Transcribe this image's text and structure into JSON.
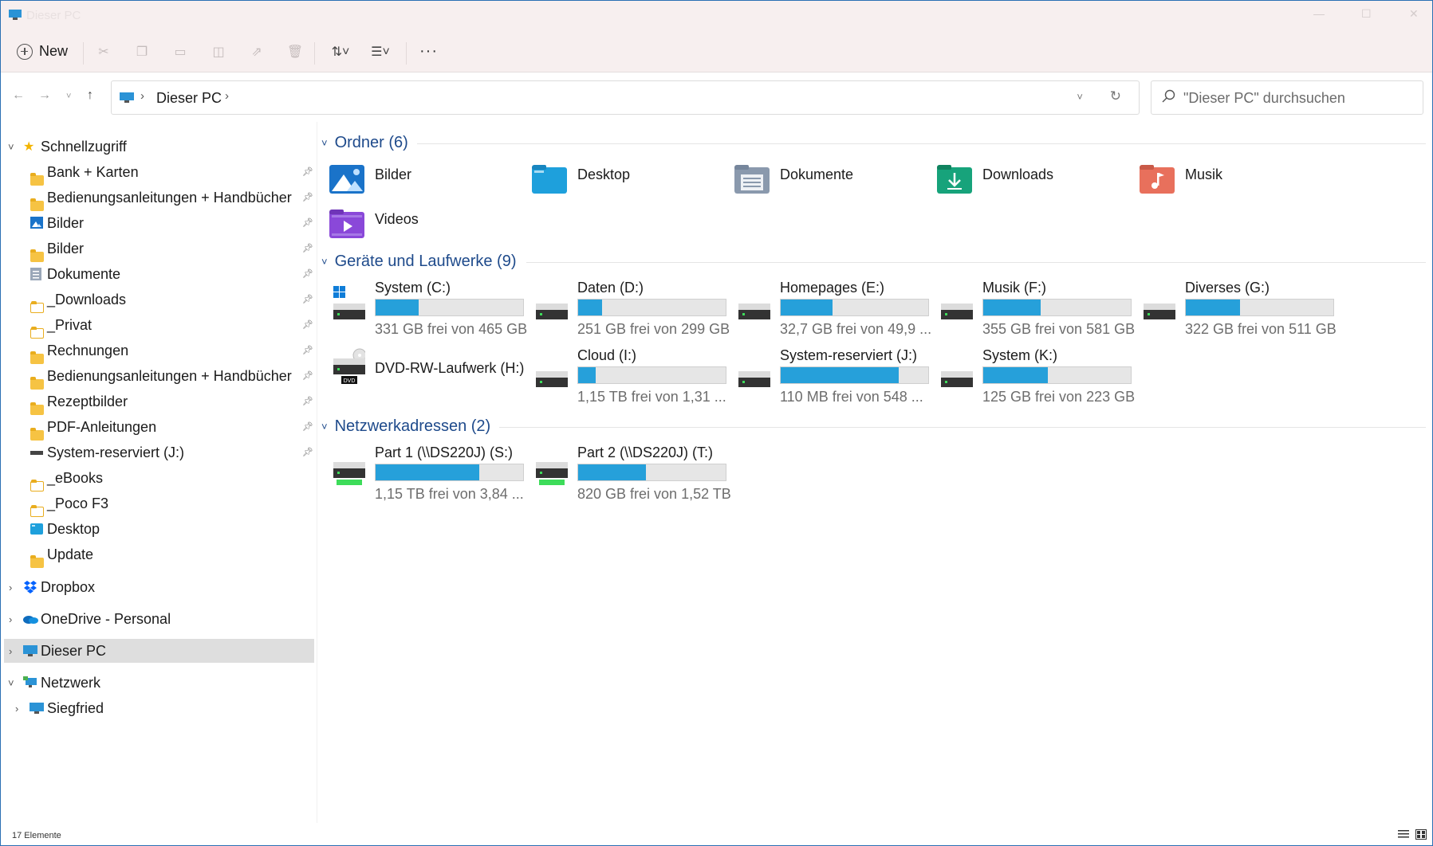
{
  "window": {
    "title": "Dieser PC"
  },
  "toolbar": {
    "new_label": "New",
    "more_label": "···"
  },
  "address": {
    "crumb": "Dieser PC",
    "search_placeholder": "\"Dieser PC\" durchsuchen"
  },
  "sidebar": {
    "quick_access": "Schnellzugriff",
    "items": [
      {
        "label": "Bank + Karten",
        "icon": "folder-icon",
        "pinned": true
      },
      {
        "label": "Bedienungsanleitungen + Handbücher",
        "icon": "folder-icon",
        "pinned": true
      },
      {
        "label": "Bilder",
        "icon": "pictures-icon",
        "pinned": true
      },
      {
        "label": "Bilder",
        "icon": "folder-icon",
        "pinned": true
      },
      {
        "label": "Dokumente",
        "icon": "documents-icon",
        "pinned": true
      },
      {
        "label": "_Downloads",
        "icon": "folder-outline-icon",
        "pinned": true
      },
      {
        "label": "_Privat",
        "icon": "folder-outline-icon",
        "pinned": true
      },
      {
        "label": "Rechnungen",
        "icon": "folder-icon",
        "pinned": true
      },
      {
        "label": "Bedienungsanleitungen + Handbücher",
        "icon": "folder-icon",
        "pinned": true
      },
      {
        "label": "Rezeptbilder",
        "icon": "folder-icon",
        "pinned": true
      },
      {
        "label": "PDF-Anleitungen",
        "icon": "folder-icon",
        "pinned": true
      },
      {
        "label": "System-reserviert (J:)",
        "icon": "drive-icon",
        "pinned": true
      },
      {
        "label": "_eBooks",
        "icon": "folder-outline-icon",
        "pinned": false
      },
      {
        "label": "_Poco F3",
        "icon": "folder-outline-icon",
        "pinned": false
      },
      {
        "label": "Desktop",
        "icon": "desktop-icon",
        "pinned": false
      },
      {
        "label": "Update",
        "icon": "folder-icon",
        "pinned": false
      }
    ],
    "dropbox": "Dropbox",
    "onedrive": "OneDrive - Personal",
    "this_pc": "Dieser PC",
    "network": "Netzwerk",
    "siegfried": "Siegfried"
  },
  "groups": {
    "folders": {
      "title": "Ordner (6)",
      "items": [
        {
          "name": "Bilder",
          "icon": "pictures-folder-icon"
        },
        {
          "name": "Desktop",
          "icon": "desktop-folder-icon"
        },
        {
          "name": "Dokumente",
          "icon": "documents-folder-icon"
        },
        {
          "name": "Downloads",
          "icon": "downloads-folder-icon"
        },
        {
          "name": "Musik",
          "icon": "music-folder-icon"
        },
        {
          "name": "Videos",
          "icon": "videos-folder-icon"
        }
      ]
    },
    "drives": {
      "title": "Geräte und Laufwerke (9)",
      "items": [
        {
          "name": "System (C:)",
          "free": "331 GB frei von 465 GB",
          "used_pct": 29,
          "icon": "windows-drive-icon"
        },
        {
          "name": "Daten (D:)",
          "free": "251 GB frei von 299 GB",
          "used_pct": 16,
          "icon": "drive-icon"
        },
        {
          "name": "Homepages (E:)",
          "free": "32,7 GB frei von 49,9 ...",
          "used_pct": 35,
          "icon": "drive-icon"
        },
        {
          "name": "Musik (F:)",
          "free": "355 GB frei von 581 GB",
          "used_pct": 39,
          "icon": "drive-icon"
        },
        {
          "name": "Diverses (G:)",
          "free": "322 GB frei von 511 GB",
          "used_pct": 37,
          "icon": "drive-icon"
        },
        {
          "name": "DVD-RW-Laufwerk (H:)",
          "free": "",
          "used_pct": null,
          "icon": "dvd-drive-icon",
          "badge": "DVD"
        },
        {
          "name": "Cloud (I:)",
          "free": "1,15 TB frei von 1,31 ...",
          "used_pct": 12,
          "icon": "drive-icon"
        },
        {
          "name": "System-reserviert (J:)",
          "free": "110 MB frei von 548 ...",
          "used_pct": 80,
          "icon": "drive-icon"
        },
        {
          "name": "System (K:)",
          "free": "125 GB frei von 223 GB",
          "used_pct": 44,
          "icon": "drive-icon"
        }
      ]
    },
    "network": {
      "title": "Netzwerkadressen (2)",
      "items": [
        {
          "name": "Part 1 (\\\\DS220J) (S:)",
          "free": "1,15 TB frei von 3,84 ...",
          "used_pct": 70,
          "icon": "network-drive-icon"
        },
        {
          "name": "Part 2 (\\\\DS220J) (T:)",
          "free": "820 GB frei von 1,52 TB",
          "used_pct": 46,
          "icon": "network-drive-icon"
        }
      ]
    }
  },
  "status": {
    "count": "17 Elemente"
  },
  "colors": {
    "accent": "#26a0da",
    "group_title": "#1e4a8b"
  }
}
